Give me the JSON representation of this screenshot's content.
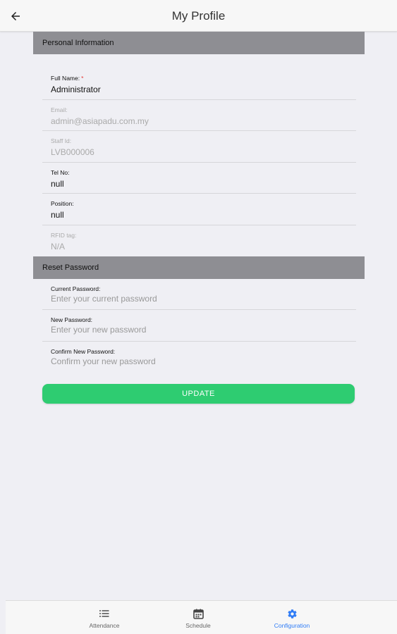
{
  "header": {
    "title": "My Profile",
    "back_icon": "arrow-left-icon"
  },
  "personal": {
    "section_title": "Personal Information",
    "fields": [
      {
        "label": "Full Name:",
        "required": "*",
        "value": "Administrator",
        "disabled": false
      },
      {
        "label": "Email:",
        "value": "admin@asiapadu.com.my",
        "disabled": true
      },
      {
        "label": "Staff Id:",
        "value": "LVB000006",
        "disabled": true
      },
      {
        "label": "Tel No:",
        "value": "null",
        "disabled": false
      },
      {
        "label": "Position:",
        "value": "null",
        "disabled": false
      },
      {
        "label": "RFID tag:",
        "value": "N/A",
        "disabled": true
      }
    ]
  },
  "reset": {
    "section_title": "Reset Password",
    "fields": [
      {
        "label": "Current Password:",
        "placeholder": "Enter your current password"
      },
      {
        "label": "New Password:",
        "placeholder": "Enter your new password"
      },
      {
        "label": "Confirm New Password:",
        "placeholder": "Confirm your new password"
      }
    ]
  },
  "update_button": {
    "label": "UPDATE",
    "color": "#2ecc71"
  },
  "tabs": [
    {
      "label": "Attendance",
      "icon": "list-icon",
      "active": false
    },
    {
      "label": "Schedule",
      "icon": "calendar-icon",
      "active": false
    },
    {
      "label": "Configuration",
      "icon": "gear-icon",
      "active": true
    }
  ],
  "colors": {
    "accent": "#2f7cf6",
    "section_header": "#8e8e93",
    "background": "#efeff4"
  }
}
